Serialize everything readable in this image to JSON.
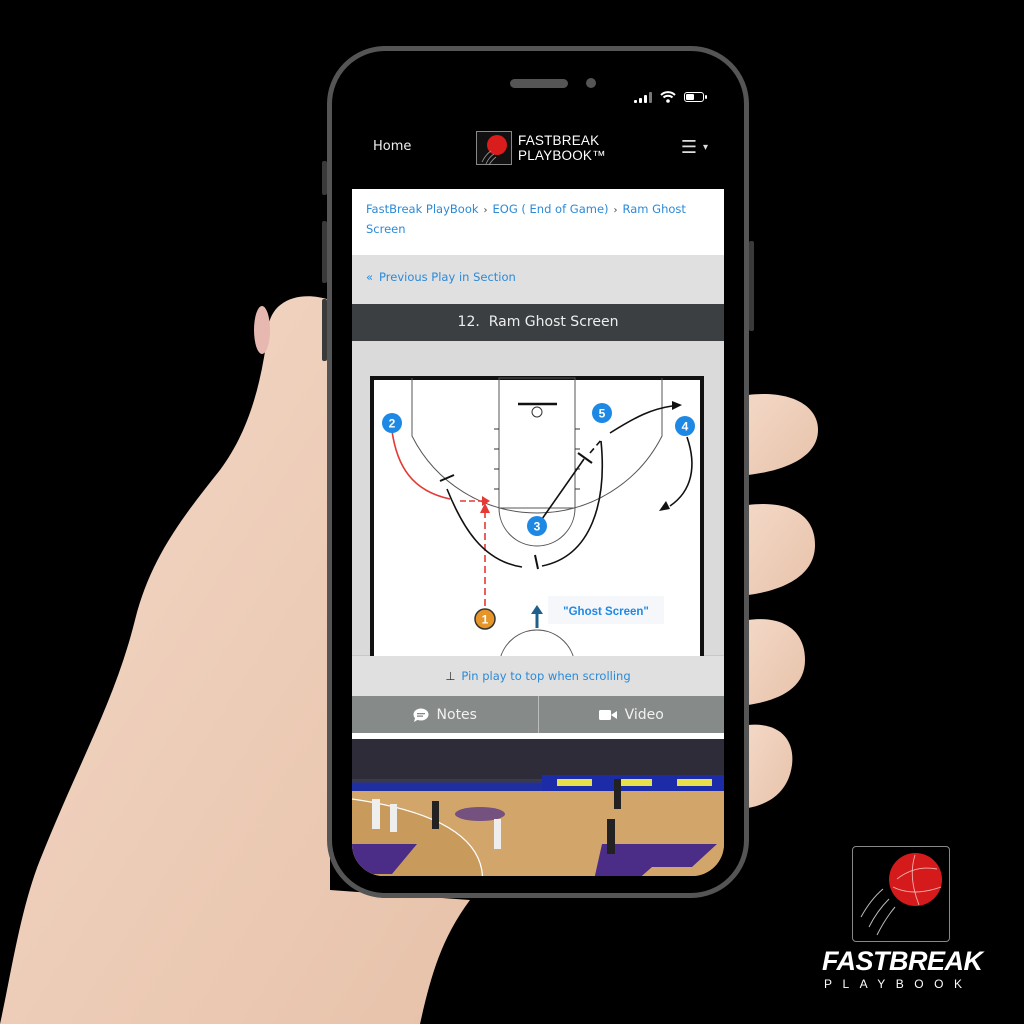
{
  "status_bar": {
    "signal": "signal-icon",
    "wifi": "wifi-icon",
    "battery_level": 0.5
  },
  "nav": {
    "home_label": "Home",
    "logo_line1": "FASTBREAK",
    "logo_line2": "PLAYBOOK™",
    "menu_icon": "☰",
    "menu_caret": "▾"
  },
  "breadcrumb": {
    "items": [
      "FastBreak PlayBook",
      "EOG ( End of Game)",
      "Ram Ghost Screen"
    ],
    "separator": "›"
  },
  "previous_play": {
    "icon": "«",
    "label": "Previous Play in Section"
  },
  "play": {
    "number": "12.",
    "title": "Ram Ghost Screen"
  },
  "diagram": {
    "players": [
      {
        "label": "2",
        "role": "offense"
      },
      {
        "label": "5",
        "role": "offense"
      },
      {
        "label": "4",
        "role": "offense"
      },
      {
        "label": "3",
        "role": "offense"
      },
      {
        "label": "1",
        "role": "ball-handler"
      }
    ],
    "annotation": "\"Ghost Screen\"",
    "colors": {
      "player": "#1e88e5",
      "pass": "#e53935",
      "move": "#111111",
      "ball": "#e69528",
      "annotation": "#1e88e5",
      "screen_arrow": "#1f5f8b"
    }
  },
  "pin": {
    "icon": "📌",
    "label": "Pin play to top when scrolling"
  },
  "actions": {
    "notes_label": "Notes",
    "video_label": "Video"
  },
  "brand": {
    "name": "FASTBREAK",
    "sub": "PLAYBOOK",
    "tm": "™"
  },
  "colors": {
    "link": "#2b8ad8",
    "title_bar": "#3b3f42",
    "button": "#868a89",
    "brand_red": "#d41a1a"
  }
}
